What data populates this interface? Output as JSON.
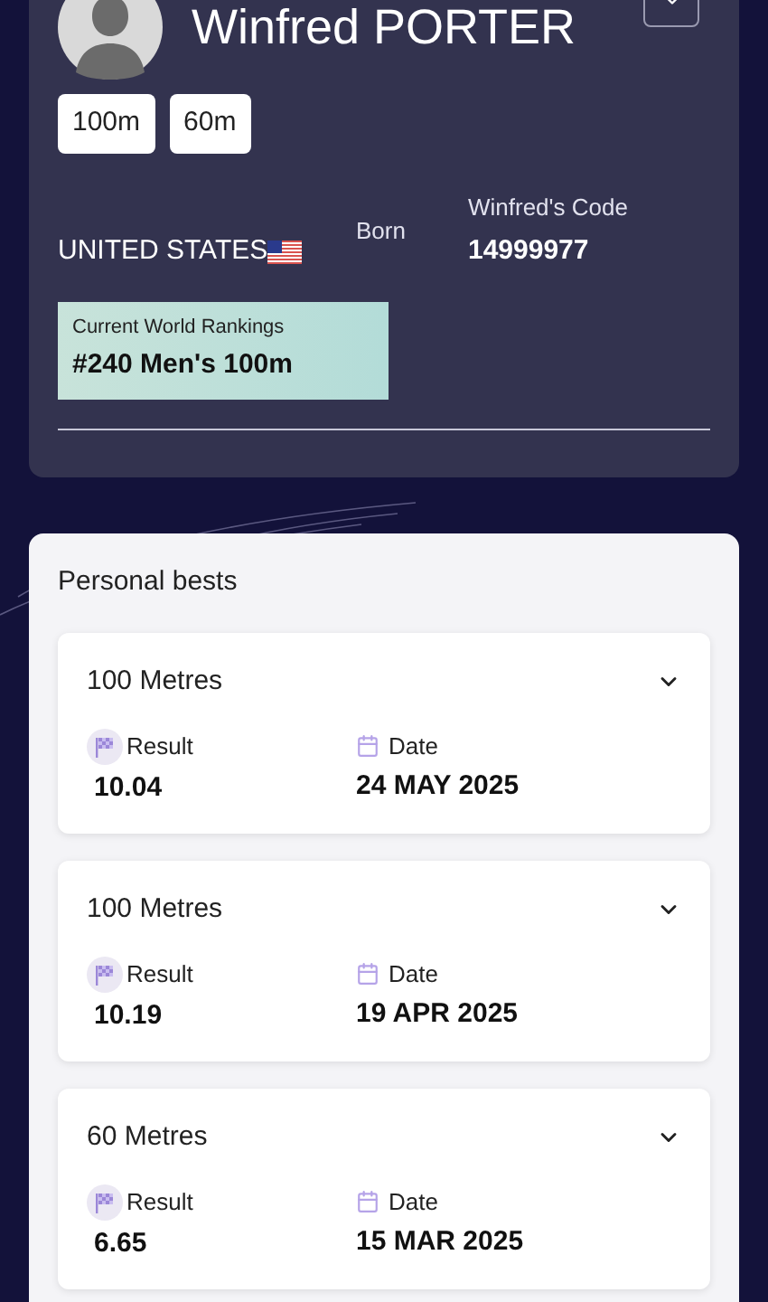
{
  "athlete": {
    "name": "Winfred PORTER",
    "disciplines": [
      "100m",
      "60m"
    ],
    "country": "UNITED STATES",
    "born_label": "Born",
    "code_label": "Winfred's Code",
    "code": "14999977",
    "ranking_label": "Current World Rankings",
    "ranking": "#240 Men's 100m"
  },
  "personal_bests": {
    "title": "Personal bests",
    "items": [
      {
        "event": "100 Metres",
        "result_label": "Result",
        "result": "10.04",
        "date_label": "Date",
        "date": "24 MAY 2025",
        "expanded": false
      },
      {
        "event": "100 Metres",
        "result_label": "Result",
        "result": "10.19",
        "date_label": "Date",
        "date": "19 APR 2025",
        "expanded": false
      },
      {
        "event": "60 Metres",
        "result_label": "Result",
        "result": "6.65",
        "date_label": "Date",
        "date": "15 MAR 2025",
        "expanded": false
      }
    ]
  }
}
